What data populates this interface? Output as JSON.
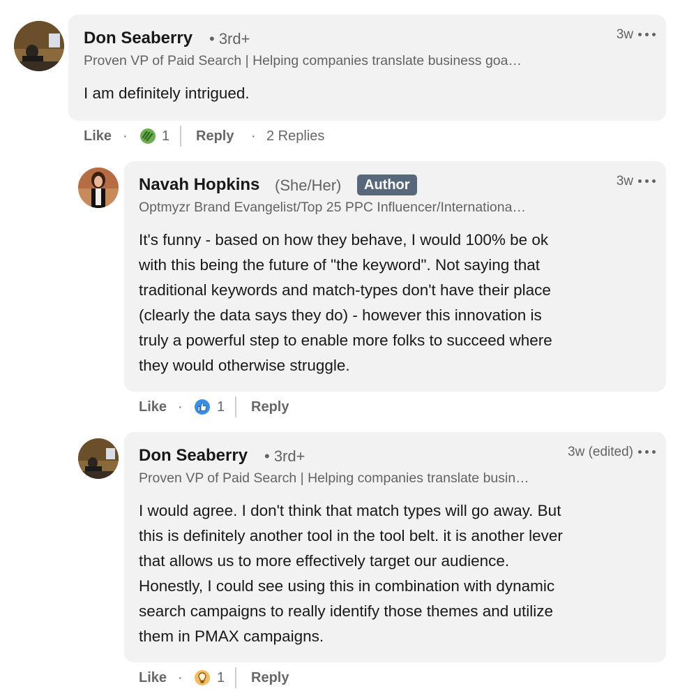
{
  "comments": [
    {
      "author": "Don Seaberry",
      "degree": "• 3rd+",
      "headline": "Proven VP of Paid Search | Helping companies translate business goa…",
      "time": "3w",
      "text": "I am definitely intrigued.",
      "actions": {
        "like": "Like",
        "dot": "·",
        "reaction_icon": "support-icon",
        "reaction_count": "1",
        "reply": "Reply",
        "replies_dot": "·",
        "replies": "2 Replies"
      }
    },
    {
      "author": "Navah Hopkins",
      "pronouns": "(She/Her)",
      "badge": "Author",
      "headline": "Optmyzr Brand Evangelist/Top 25 PPC Influencer/Internationa…",
      "time": "3w",
      "text_lines": [
        "It's funny - based on how they behave, I would 100% be ok",
        "with this being the future of \"the keyword\". Not saying that",
        "traditional keywords and match-types don't have their place",
        "(clearly the data says they do) - however this innovation is",
        "truly a powerful step to enable more folks to succeed where",
        "they would otherwise struggle."
      ],
      "actions": {
        "like": "Like",
        "dot": "·",
        "reaction_icon": "like-thumb-icon",
        "reaction_count": "1",
        "reply": "Reply"
      }
    },
    {
      "author": "Don Seaberry",
      "degree": "• 3rd+",
      "headline": "Proven VP of Paid Search | Helping companies translate busin…",
      "time": "3w (edited)",
      "text_lines": [
        "I would agree. I don't think that match types will go away. But",
        "this is definitely another tool in the tool belt. it is another lever",
        "that allows us to more effectively target our audience.",
        "Honestly, I could see using this in combination with dynamic",
        "search campaigns to really identify those themes and utilize",
        "them in PMAX campaigns."
      ],
      "actions": {
        "like": "Like",
        "dot": "·",
        "reaction_icon": "insightful-bulb-icon",
        "reaction_count": "1",
        "reply": "Reply"
      }
    }
  ],
  "colors": {
    "bubble": "#f2f2f2",
    "badge": "#56687a",
    "like_blue": "#378fe9",
    "support_green": "#6dae4f",
    "insight_yellow": "#f5bb5c"
  }
}
